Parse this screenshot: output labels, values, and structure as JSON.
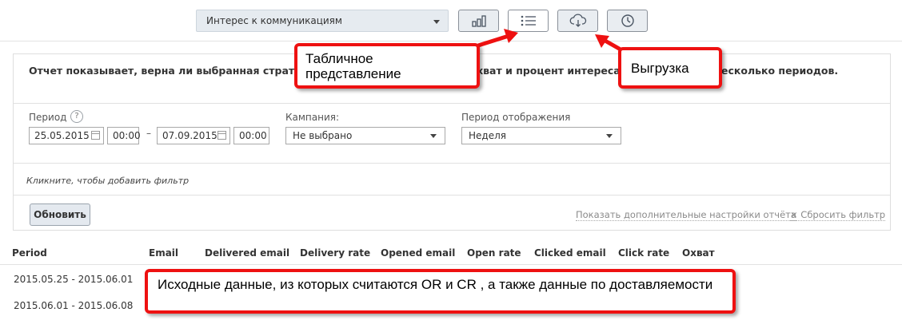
{
  "toolbar": {
    "report_select": "Интерес к коммуникациям",
    "buttons": [
      {
        "icon": "bar-chart-icon",
        "active": false
      },
      {
        "icon": "list-icon",
        "active": true
      },
      {
        "icon": "cloud-download-icon",
        "active": false
      },
      {
        "icon": "clock-icon",
        "active": false
      }
    ]
  },
  "panel": {
    "description": "Отчет показывает, верна ли выбранная стратегия отправки, регулярность, охват и процент интереса в динамике, за несколько периодов.",
    "period_label": "Период",
    "help_mark": "?",
    "date_from": "25.05.2015",
    "time_from": "00:00",
    "date_sep": "–",
    "date_to": "07.09.2015",
    "time_to": "00:00",
    "campaign_label": "Кампания:",
    "campaign_value": "Не выбрано",
    "display_period_label": "Период отображения",
    "display_period_value": "Неделя",
    "filter_hint": "Кликните, чтобы добавить фильтр",
    "refresh_button": "Обновить",
    "more_settings_link": "Показать дополнительные настройки отчёта",
    "reset_filter_link": "× Сбросить фильтр"
  },
  "table": {
    "columns": [
      "Period",
      "Email",
      "Delivered email",
      "Delivery rate",
      "Opened email",
      "Open rate",
      "Clicked email",
      "Click rate",
      "Охват"
    ],
    "rows": [
      {
        "period": "2015.05.25 - 2015.06.01"
      },
      {
        "period": "2015.06.01 - 2015.06.08"
      }
    ]
  },
  "annotations": {
    "table_view": "Табличное представление",
    "export": "Выгрузка",
    "source_data": "Исходные данные, из которых считаются OR и CR , а также данные по доставляемости"
  },
  "colors": {
    "annotation_border": "#ee1111",
    "button_bg": "#e9edf1",
    "select_bg": "#e6ebf0"
  }
}
